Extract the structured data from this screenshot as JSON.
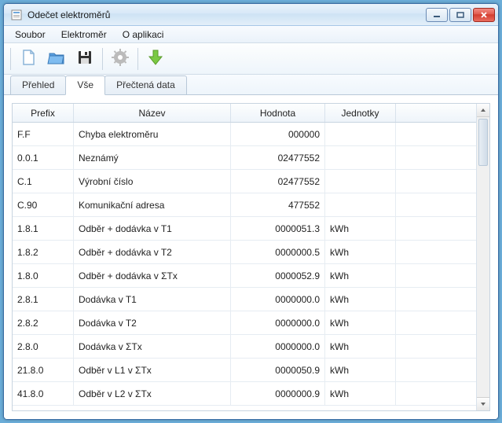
{
  "window": {
    "title": "Odečet elektroměrů"
  },
  "menu": {
    "items": [
      "Soubor",
      "Elektroměr",
      "O aplikaci"
    ]
  },
  "toolbar": {
    "icons": [
      "new-file-icon",
      "open-folder-icon",
      "save-icon",
      "settings-gear-icon",
      "download-arrow-icon"
    ]
  },
  "tabs": [
    {
      "label": "Přehled",
      "active": false
    },
    {
      "label": "Vše",
      "active": true
    },
    {
      "label": "Přečtená data",
      "active": false
    }
  ],
  "grid": {
    "headers": {
      "prefix": "Prefix",
      "name": "Název",
      "value": "Hodnota",
      "unit": "Jednotky"
    },
    "rows": [
      {
        "prefix": "F.F",
        "name": "Chyba elektroměru",
        "value": "000000",
        "unit": ""
      },
      {
        "prefix": "0.0.1",
        "name": "Neznámý",
        "value": "02477552",
        "unit": ""
      },
      {
        "prefix": "C.1",
        "name": "Výrobní číslo",
        "value": "02477552",
        "unit": ""
      },
      {
        "prefix": "C.90",
        "name": "Komunikační adresa",
        "value": "477552",
        "unit": ""
      },
      {
        "prefix": "1.8.1",
        "name": "Odběr + dodávka v T1",
        "value": "0000051.3",
        "unit": "kWh"
      },
      {
        "prefix": "1.8.2",
        "name": "Odběr + dodávka v T2",
        "value": "0000000.5",
        "unit": "kWh"
      },
      {
        "prefix": "1.8.0",
        "name": "Odběr + dodávka v ΣTx",
        "value": "0000052.9",
        "unit": "kWh"
      },
      {
        "prefix": "2.8.1",
        "name": "Dodávka v T1",
        "value": "0000000.0",
        "unit": "kWh"
      },
      {
        "prefix": "2.8.2",
        "name": "Dodávka v T2",
        "value": "0000000.0",
        "unit": "kWh"
      },
      {
        "prefix": "2.8.0",
        "name": "Dodávka v ΣTx",
        "value": "0000000.0",
        "unit": "kWh"
      },
      {
        "prefix": "21.8.0",
        "name": "Odběr v L1 v ΣTx",
        "value": "0000050.9",
        "unit": "kWh"
      },
      {
        "prefix": "41.8.0",
        "name": "Odběr v L2 v ΣTx",
        "value": "0000000.9",
        "unit": "kWh"
      }
    ]
  }
}
